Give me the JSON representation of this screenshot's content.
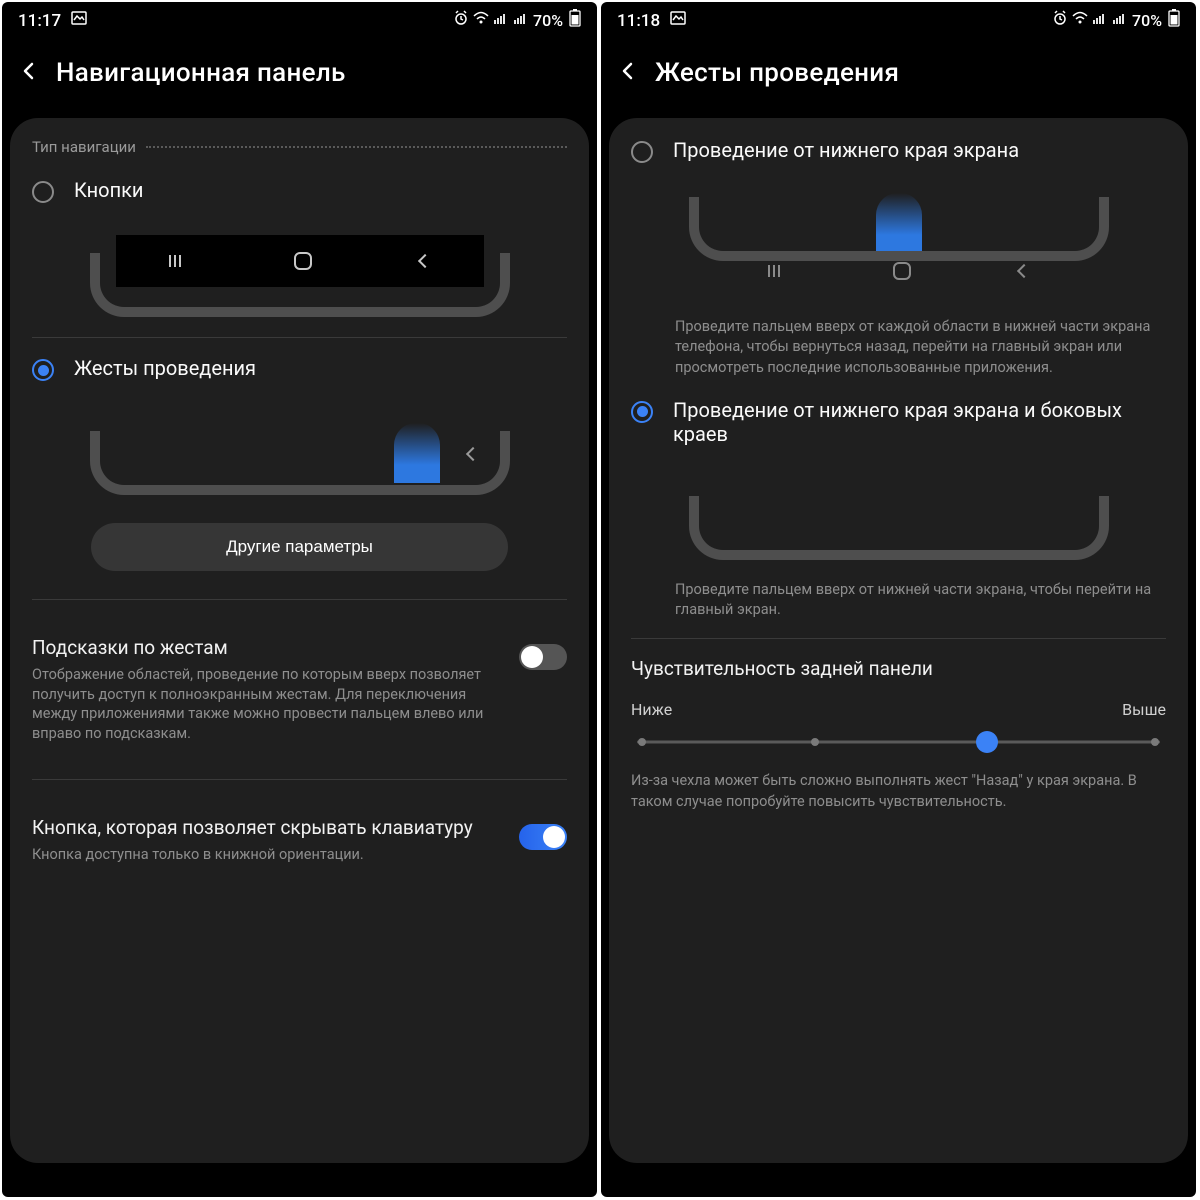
{
  "left": {
    "statusbar": {
      "time": "11:17",
      "battery": "70%"
    },
    "title": "Навигационная панель",
    "nav_type_label": "Тип навигации",
    "option_buttons": {
      "label": "Кнопки",
      "selected": false
    },
    "option_gestures": {
      "label": "Жесты проведения",
      "selected": true
    },
    "more_button": "Другие параметры",
    "hints": {
      "title": "Подсказки по жестам",
      "desc": "Отображение областей, проведение по которым вверх позволяет получить доступ к полноэкранным жестам. Для переключения между приложениями также можно провести пальцем влево или вправо по подсказкам.",
      "on": false
    },
    "hide_kb": {
      "title": "Кнопка, которая позволяет скрывать клавиатуру",
      "desc": "Кнопка доступна только в книжной ориентации.",
      "on": true
    }
  },
  "right": {
    "statusbar": {
      "time": "11:18",
      "battery": "70%"
    },
    "title": "Жесты проведения",
    "opt1": {
      "label": "Проведение от нижнего края экрана",
      "desc": "Проведите пальцем вверх от каждой области в нижней части экрана телефона, чтобы вернуться назад, перейти на главный экран или просмотреть последние использованные приложения.",
      "selected": false
    },
    "opt2": {
      "label": "Проведение от нижнего края экрана и боковых краев",
      "desc": "Проведите пальцем вверх от нижней части экрана, чтобы перейти на главный экран.",
      "selected": true
    },
    "sensitivity": {
      "title": "Чувствительность задней панели",
      "low": "Ниже",
      "high": "Выше",
      "ticks": 4,
      "value_index": 2,
      "note": "Из-за чехла может быть сложно выполнять жест \"Назад\" у края экрана. В таком случае попробуйте повысить чувствительность."
    }
  }
}
